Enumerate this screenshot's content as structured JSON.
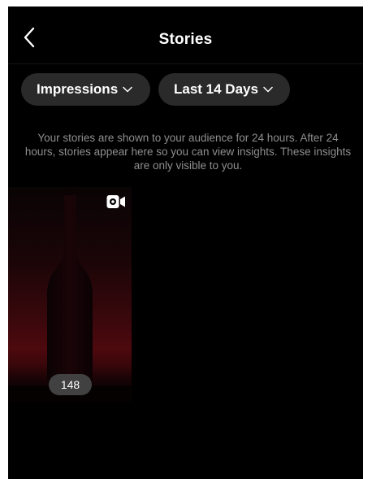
{
  "header": {
    "title": "Stories",
    "back_icon": "chevron-left-icon"
  },
  "filters": {
    "metric_label": "Impressions",
    "period_label": "Last 14 Days",
    "dropdown_icon": "chevron-down-icon"
  },
  "info_text": "Your stories are shown to your audience for 24 hours. After 24 hours, stories appear here so you can view insights. These insights are only visible to you.",
  "stories": [
    {
      "media_type_icon": "video-camera-icon",
      "count": "148"
    }
  ],
  "colors": {
    "background": "#000000",
    "pill_background": "#2a2a2a",
    "text_primary": "#ffffff",
    "text_secondary": "#8e8e8e",
    "story_tint": "#4d090e"
  }
}
